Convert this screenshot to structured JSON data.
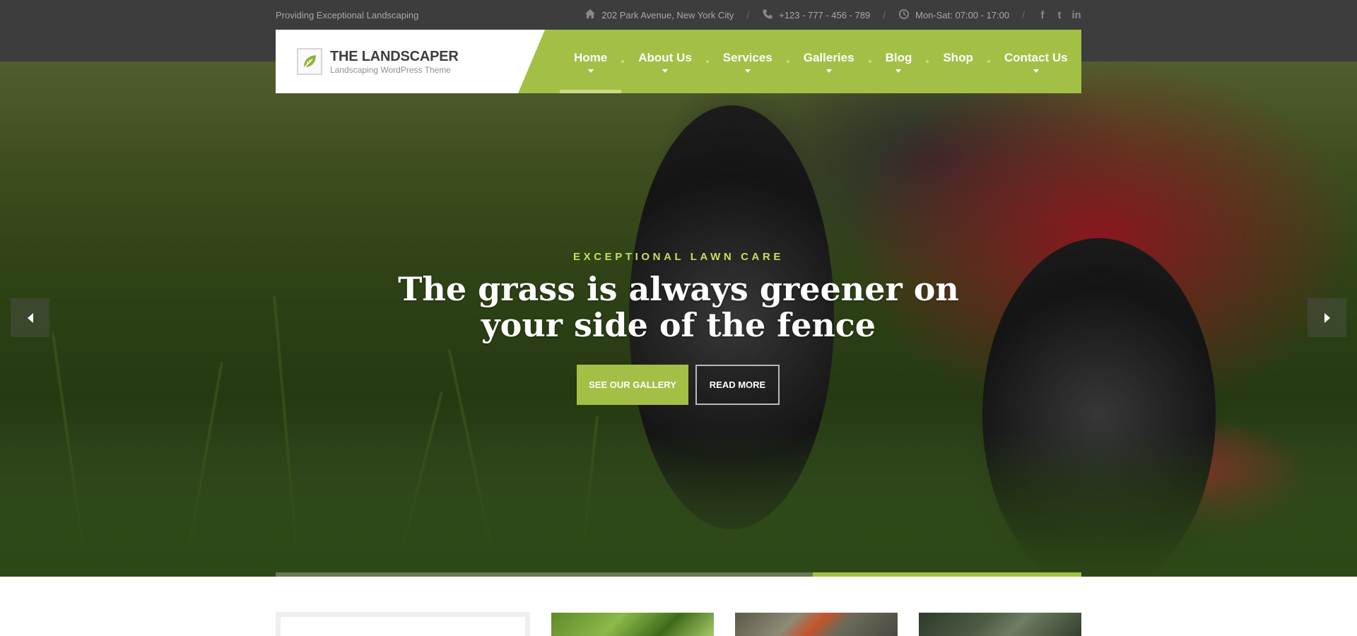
{
  "topbar": {
    "tagline": "Providing Exceptional Landscaping",
    "address": "202 Park Avenue, New York City",
    "phone": "+123 - 777 - 456 - 789",
    "hours": "Mon-Sat: 07:00 - 17:00",
    "separator": "/",
    "social_glyphs": [
      "f",
      "t",
      "in"
    ],
    "social_icons": [
      "facebook-icon",
      "twitter-icon",
      "linkedin-icon"
    ]
  },
  "logo": {
    "title": "THE LANDSCAPER",
    "subtitle": "Landscaping WordPress Theme"
  },
  "nav": {
    "items": [
      {
        "label": "Home",
        "has_dropdown": true,
        "active": true
      },
      {
        "label": "About Us",
        "has_dropdown": true
      },
      {
        "label": "Services",
        "has_dropdown": true
      },
      {
        "label": "Galleries",
        "has_dropdown": true
      },
      {
        "label": "Blog",
        "has_dropdown": true
      },
      {
        "label": "Shop",
        "has_dropdown": false
      },
      {
        "label": "Contact Us",
        "has_dropdown": true
      }
    ]
  },
  "hero": {
    "eyebrow": "EXCEPTIONAL LAWN CARE",
    "headline": "The grass is always greener on your side of the fence",
    "primary_button": "SEE OUR GALLERY",
    "secondary_button": "READ MORE",
    "slide_progress": 0.667
  },
  "colors": {
    "accent": "#a2c046",
    "topbar_bg": "#3d3d3d",
    "eyebrow": "#c9de5c"
  }
}
